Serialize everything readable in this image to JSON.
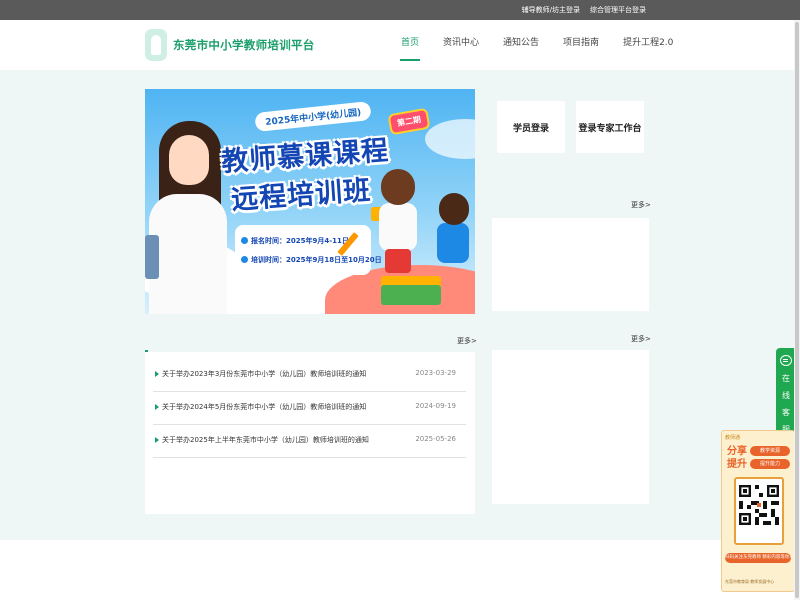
{
  "topbar": {
    "links": [
      "辅导教师/坊主登录",
      "综合管理平台登录"
    ]
  },
  "header": {
    "site_title": "东莞市中小学教师培训平台",
    "logo_icon": "teacher-silhouette-icon",
    "nav": [
      {
        "label": "首页",
        "active": true
      },
      {
        "label": "资讯中心",
        "active": false
      },
      {
        "label": "通知公告",
        "active": false
      },
      {
        "label": "项目指南",
        "active": false
      },
      {
        "label": "提升工程2.0",
        "active": false
      }
    ]
  },
  "banner": {
    "subtitle": "2025年中小学(幼儿园)",
    "issue": "第二期",
    "title_line1": "教师慕课课程",
    "title_line2": "远程培训班",
    "enroll": "报名时间：2025年9月4-11日",
    "train": "培训时间：2025年9月18日至10月20日"
  },
  "news": {
    "more": "更多>",
    "items": [
      {
        "title": "关于举办2023年3月份东莞市中小学（幼儿园）教师培训班的通知",
        "date": "2023-03-29"
      },
      {
        "title": "关于举办2024年5月份东莞市中小学（幼儿园）教师培训班的通知",
        "date": "2024-09-19"
      },
      {
        "title": "关于举办2025年上半年东莞市中小学（幼儿园）教师培训班的通知",
        "date": "2025-05-26"
      }
    ]
  },
  "right": {
    "student_login": "学员登录",
    "expert_login": "登录专家工作台",
    "more1": "更多>",
    "more2": "更多>"
  },
  "service": {
    "label": "在线客服",
    "icon": "chat-bubble-icon"
  },
  "qr": {
    "brand": "教师通",
    "headline": "分享提升",
    "tag1": "教学资源",
    "tag2": "提升能力",
    "band": "扫码关注东莞教师 精彩内容等你来",
    "footer": "东莞市教育局 教师发展中心",
    "accent": "#e8642a"
  },
  "colors": {
    "brand_green": "#1a9e6c",
    "topbar": "#5a5a5a",
    "main_bg": "#eef7f5"
  }
}
